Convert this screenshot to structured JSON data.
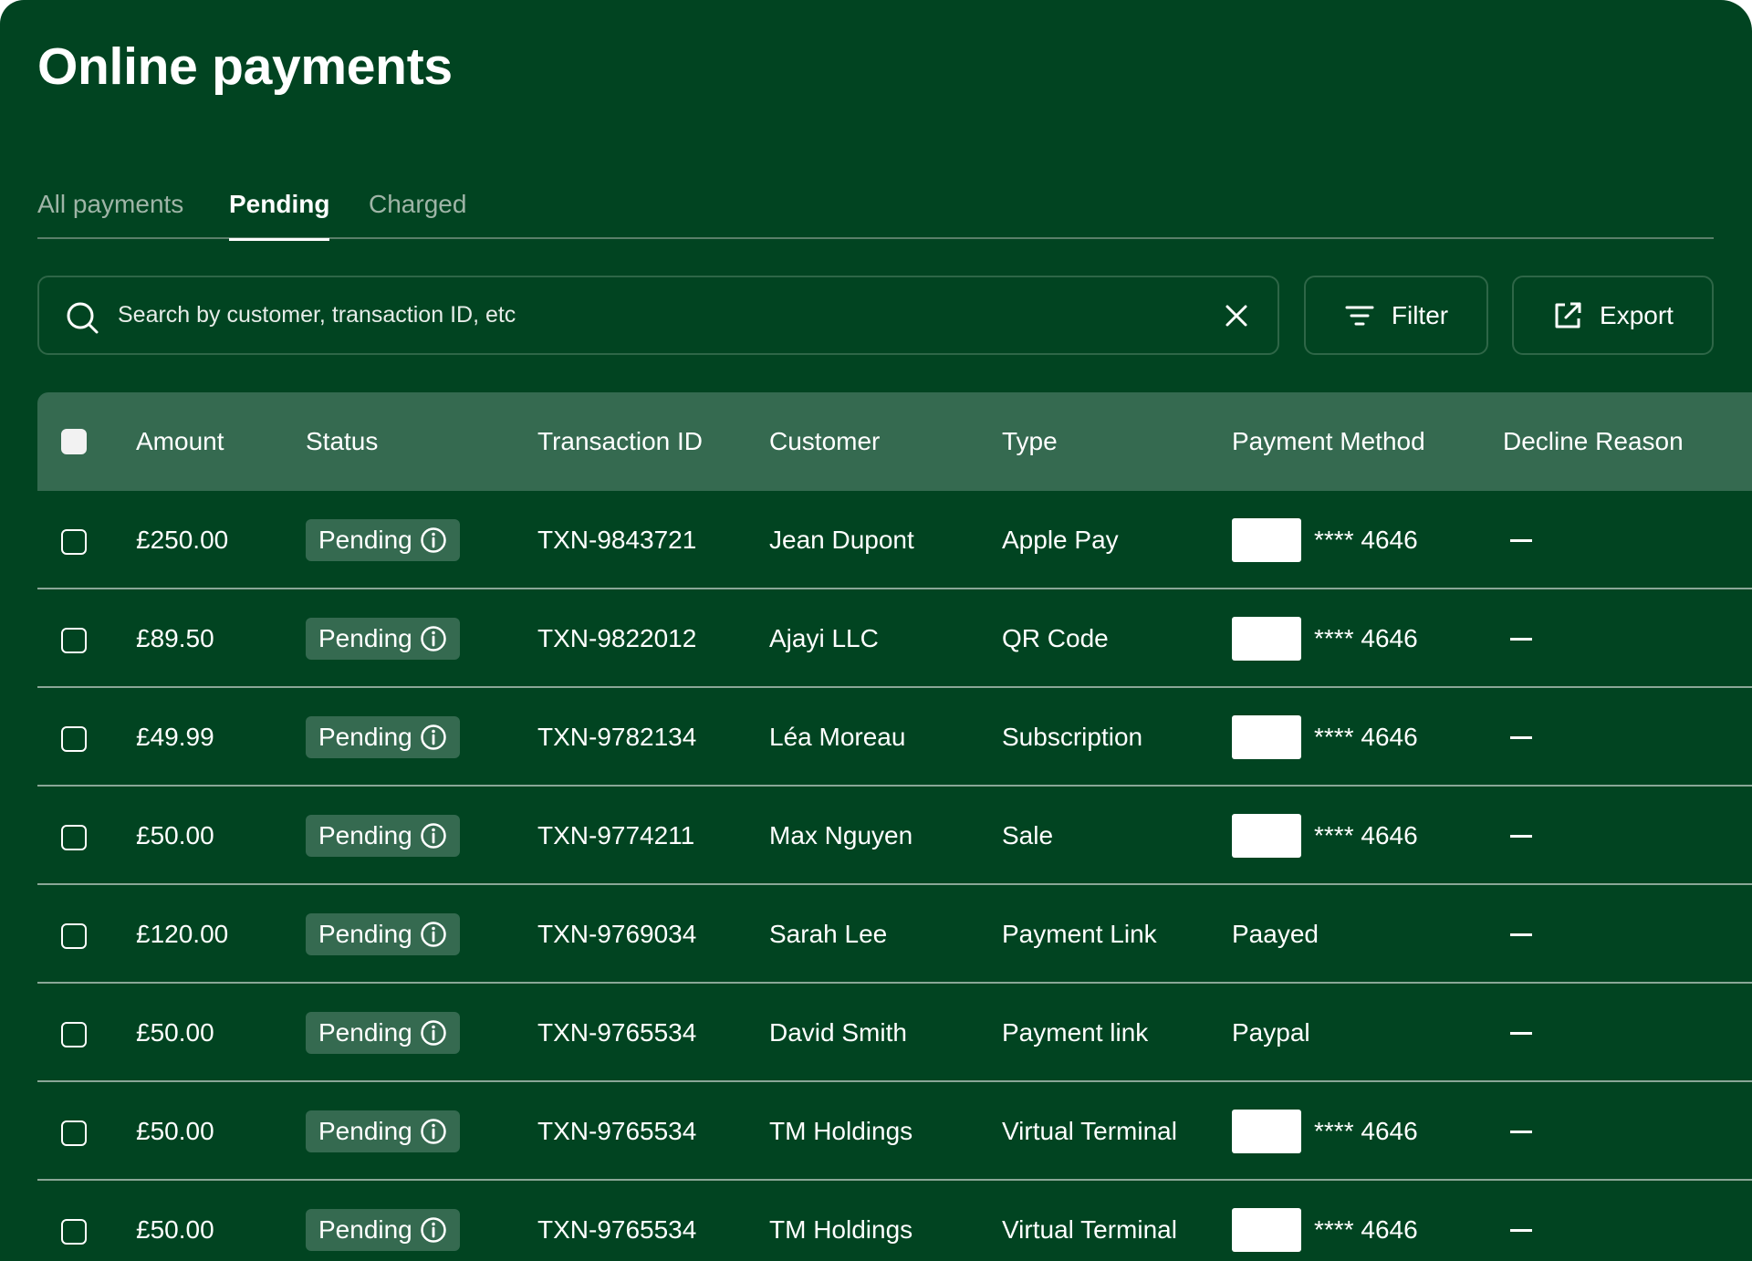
{
  "page": {
    "title": "Online payments"
  },
  "tabs": [
    {
      "label": "All payments",
      "active": false
    },
    {
      "label": "Pending",
      "active": true
    },
    {
      "label": "Charged",
      "active": false
    }
  ],
  "search": {
    "placeholder": "Search by customer, transaction ID, etc",
    "value": ""
  },
  "toolbar": {
    "filter_label": "Filter",
    "export_label": "Export"
  },
  "table": {
    "columns": [
      "Amount",
      "Status",
      "Transaction ID",
      "Customer",
      "Type",
      "Payment Method",
      "Decline Reason"
    ],
    "rows": [
      {
        "amount": "£250.00",
        "status": "Pending",
        "txn": "TXN-9843721",
        "customer": "Jean Dupont",
        "type": "Apple Pay",
        "method": "**** 4646",
        "card": true,
        "decline": "—"
      },
      {
        "amount": "£89.50",
        "status": "Pending",
        "txn": "TXN-9822012",
        "customer": "Ajayi LLC",
        "type": "QR Code",
        "method": "**** 4646",
        "card": true,
        "decline": "—"
      },
      {
        "amount": "£49.99",
        "status": "Pending",
        "txn": "TXN-9782134",
        "customer": "Léa Moreau",
        "type": "Subscription",
        "method": "**** 4646",
        "card": true,
        "decline": "—"
      },
      {
        "amount": "£50.00",
        "status": "Pending",
        "txn": "TXN-9774211",
        "customer": "Max Nguyen",
        "type": "Sale",
        "method": "**** 4646",
        "card": true,
        "decline": "—"
      },
      {
        "amount": "£120.00",
        "status": "Pending",
        "txn": "TXN-9769034",
        "customer": "Sarah Lee",
        "type": "Payment Link",
        "method": "Paayed",
        "card": false,
        "decline": "—"
      },
      {
        "amount": "£50.00",
        "status": "Pending",
        "txn": "TXN-9765534",
        "customer": "David Smith",
        "type": "Payment link",
        "method": "Paypal",
        "card": false,
        "decline": "—"
      },
      {
        "amount": "£50.00",
        "status": "Pending",
        "txn": "TXN-9765534",
        "customer": "TM Holdings",
        "type": "Virtual Terminal",
        "method": "**** 4646",
        "card": true,
        "decline": "—"
      },
      {
        "amount": "£50.00",
        "status": "Pending",
        "txn": "TXN-9765534",
        "customer": "TM Holdings",
        "type": "Virtual Terminal",
        "method": "**** 4646",
        "card": true,
        "decline": "—"
      }
    ]
  },
  "colors": {
    "background": "#014421",
    "header": "#356a50",
    "badge": "#356a50",
    "divider": "#8aa797"
  }
}
